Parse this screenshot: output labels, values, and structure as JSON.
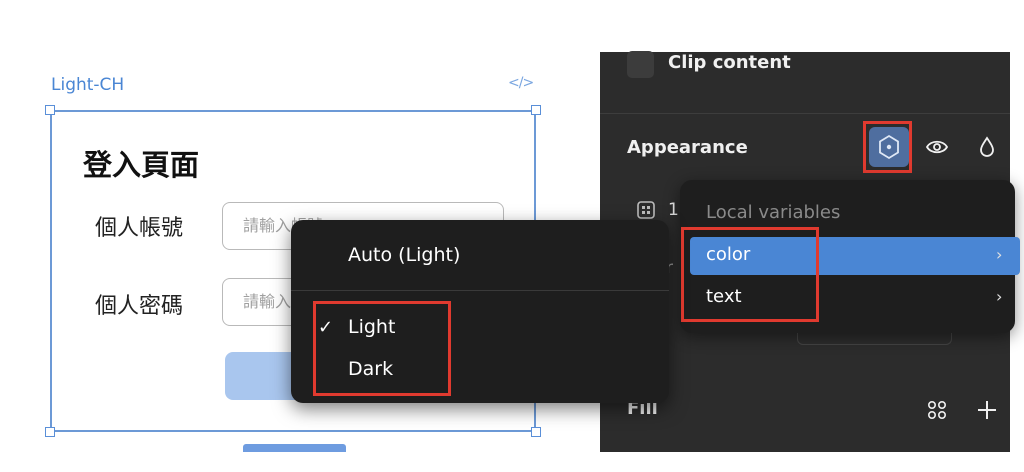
{
  "canvas": {
    "frame_name": "Light-CH",
    "code_icon": "</>",
    "page_title": "登入頁面",
    "account_label": "個人帳號",
    "account_placeholder": "請輸入帳號",
    "password_label": "個人密碼",
    "password_placeholder": "請輸入密碼"
  },
  "panel": {
    "clip_content": "Clip content",
    "appearance": "Appearance",
    "fill": "Fill",
    "partial_value": "1",
    "partial_label": "r"
  },
  "variables_menu": {
    "header": "Local variables",
    "items": [
      {
        "label": "color",
        "selected": true
      },
      {
        "label": "text",
        "selected": false
      }
    ]
  },
  "mode_menu": {
    "auto": "Auto (Light)",
    "options": [
      {
        "label": "Light",
        "checked": true
      },
      {
        "label": "Dark",
        "checked": false
      }
    ],
    "check_glyph": "✓"
  },
  "colors": {
    "panel_bg": "#2c2c2c",
    "menu_bg": "#1e1e1e",
    "accent": "#4a86d4",
    "highlight": "#e03a2f"
  },
  "icons": [
    "code-icon",
    "variables-icon",
    "eye-icon",
    "drop-icon",
    "grid-icon",
    "dots-grid-icon",
    "plus-icon",
    "check-icon",
    "chevron-right-icon"
  ]
}
